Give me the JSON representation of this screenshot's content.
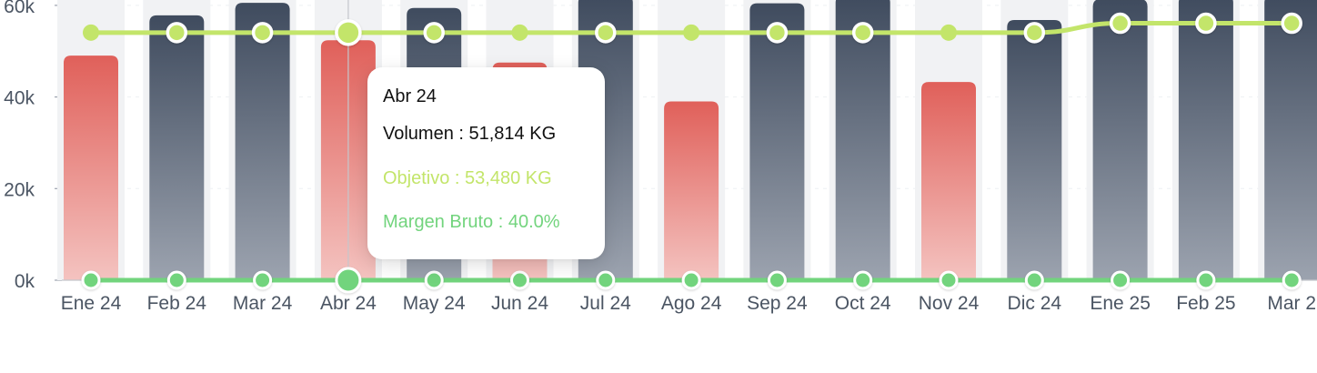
{
  "chart_data": {
    "type": "bar",
    "categories": [
      "Ene 24",
      "Feb 24",
      "Mar 24",
      "Abr 24",
      "May 24",
      "Jun 24",
      "Jul 24",
      "Ago 24",
      "Sep 24",
      "Oct 24",
      "Nov 24",
      "Dic 24",
      "Ene 25",
      "Feb 25",
      "Mar 2"
    ],
    "series": [
      {
        "name": "Volumen",
        "type": "bar",
        "values": [
          48500,
          57200,
          59900,
          51814,
          58800,
          47000,
          61500,
          38600,
          59800,
          61500,
          42800,
          56200,
          60700,
          61500,
          61500
        ]
      },
      {
        "name": "Objetivo",
        "type": "line",
        "values": [
          53480,
          53480,
          53480,
          53480,
          53480,
          53480,
          53480,
          53480,
          53480,
          53480,
          53480,
          53480,
          55500,
          55500,
          55500
        ]
      },
      {
        "name": "Margen Bruto",
        "type": "line",
        "values": [
          0,
          0,
          0,
          0,
          0,
          0,
          0,
          0,
          0,
          0,
          0,
          0,
          0,
          0,
          0
        ]
      }
    ],
    "yticks": [
      "0k",
      "20k",
      "40k",
      "60k"
    ],
    "ylim": [
      0,
      61500
    ],
    "grid": true,
    "highlight_index": 3,
    "colors": {
      "bar_above_target_top": "#3f4b5e",
      "bar_above_target_bottom": "#9ca3af",
      "bar_below_target_top": "#e0605a",
      "bar_below_target_bottom": "#f4c3c0",
      "bar_shadow": "#f1f2f4",
      "objetivo_line": "#c3e56a",
      "margen_line": "#72d47d",
      "grid": "#eef0f3",
      "crosshair": "#c4c7cc"
    }
  },
  "tooltip": {
    "title": "Abr 24",
    "volumen": "Volumen : 51,814 KG",
    "objetivo": "Objetivo : 53,480 KG",
    "margen": "Margen Bruto : 40.0%",
    "objetivo_color": "#c3e56a",
    "margen_color": "#72d47d"
  }
}
